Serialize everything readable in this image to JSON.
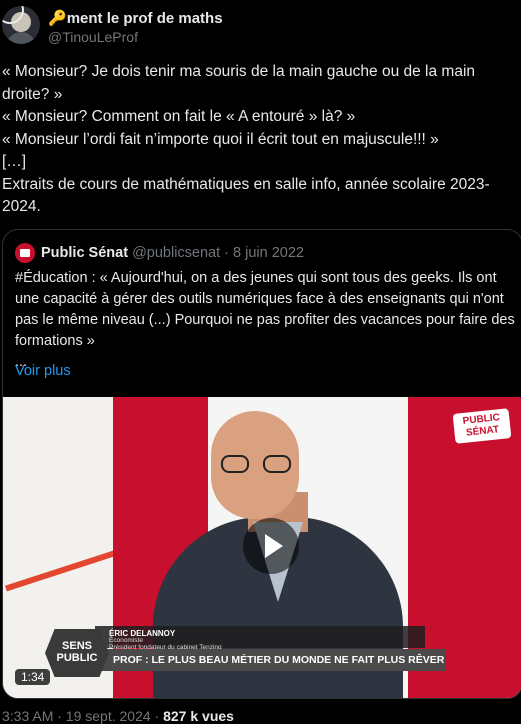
{
  "author": {
    "display_name": "ment le prof de maths",
    "name_emoji": "🔑",
    "handle": "@TinouLeProf"
  },
  "tweet": {
    "lines": [
      "« Monsieur? Je dois tenir ma souris de la main gauche ou de la main droite? »",
      "« Monsieur? Comment on fait le « A entouré » là? »",
      "« Monsieur l’ordi fait n’importe quoi il écrit tout en majuscule!!! »",
      "[…]",
      "Extraits de cours de mathématiques en salle info, année scolaire 2023-2024."
    ]
  },
  "quote": {
    "name": "Public Sénat",
    "handle": "@publicsenat",
    "separator": "·",
    "date": "8 juin 2022",
    "text_lines": [
      "#Éducation : « Aujourd'hui, on a des jeunes qui sont tous des geeks. Ils ont une capacité à gérer des outils numériques face à des enseignants qui n'ont pas le même niveau (...) Pourquoi ne pas profiter des vacances pour faire des formations »",
      "..."
    ],
    "show_more": "Voir plus"
  },
  "video": {
    "channel_logo": "PUBLIC SÉNAT",
    "show_badge": "SENS PUBLIC",
    "guest_name": "ÉRIC DELANNOY",
    "guest_role1": "Économiste",
    "guest_role2": "Président fondateur du cabinet Tenzing",
    "headline": "PROF : LE PLUS BEAU MÉTIER DU MONDE NE FAIT PLUS RÊVER",
    "duration": "1:34"
  },
  "footer": {
    "time": "3:33 AM · 19 sept. 2024 ·",
    "views": "827 k vues"
  },
  "colors": {
    "background": "#000000",
    "text": "#e7e9ea",
    "muted": "#71767b",
    "link": "#1d9bf0",
    "brand_red": "#c8102e"
  }
}
